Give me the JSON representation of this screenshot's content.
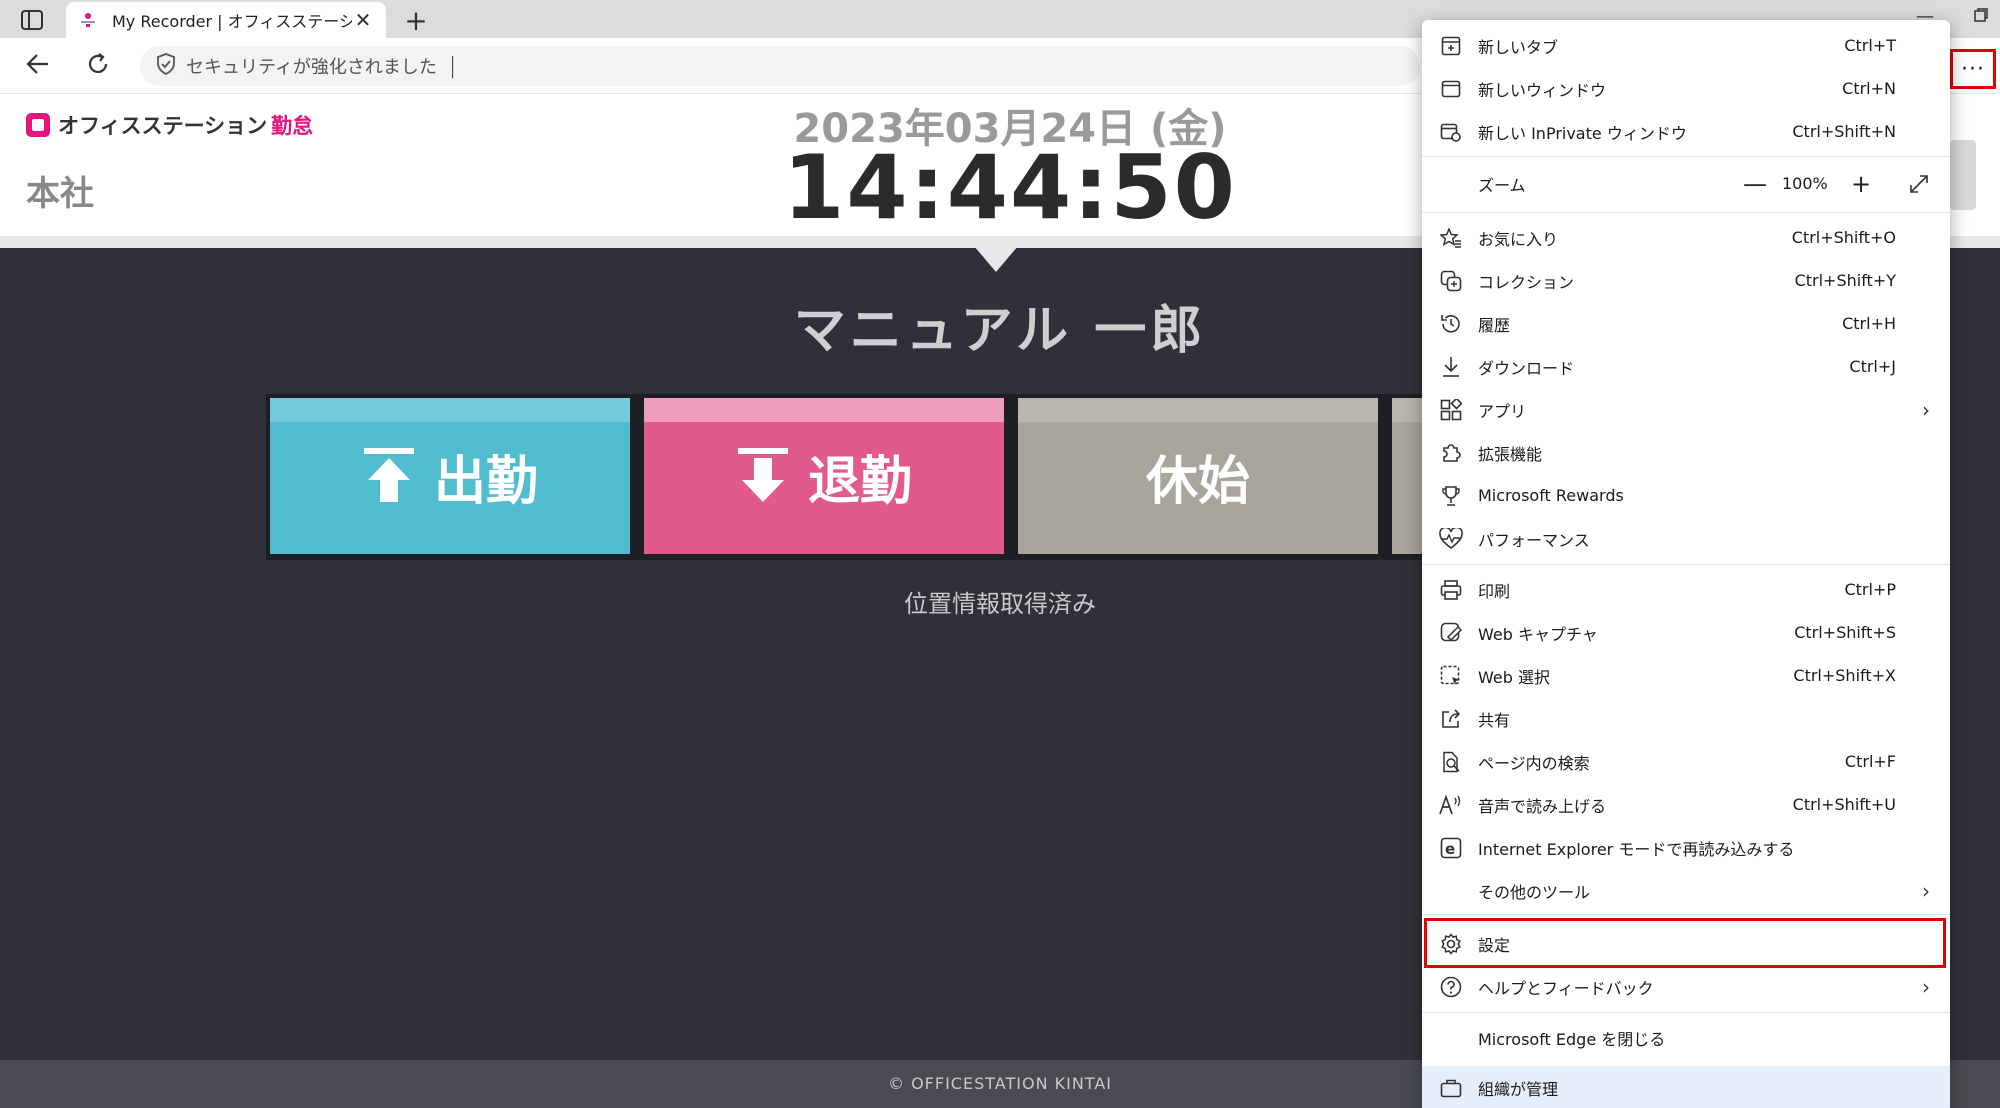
{
  "browser": {
    "tab_title": "My Recorder | オフィスステーション勤",
    "address_text": "セキュリティが強化されました",
    "more_label": "···"
  },
  "header": {
    "logo_text": "オフィスステーション",
    "logo_accent": "勤怠",
    "office": "本社",
    "date": "2023年03月24日 (金)",
    "time": "14:44:50"
  },
  "main": {
    "employee_name": "マニュアル 一郎",
    "buttons": {
      "clock_in": "出勤",
      "clock_out": "退勤",
      "break_start": "休始"
    },
    "location_status": "位置情報取得済み",
    "footer": "© OFFICESTATION KINTAI"
  },
  "menu": {
    "new_tab": {
      "label": "新しいタブ",
      "shortcut": "Ctrl+T"
    },
    "new_window": {
      "label": "新しいウィンドウ",
      "shortcut": "Ctrl+N"
    },
    "new_inprivate": {
      "label": "新しい InPrivate ウィンドウ",
      "shortcut": "Ctrl+Shift+N"
    },
    "zoom": {
      "label": "ズーム",
      "value": "100%",
      "minus": "—",
      "plus": "+"
    },
    "favorites": {
      "label": "お気に入り",
      "shortcut": "Ctrl+Shift+O"
    },
    "collections": {
      "label": "コレクション",
      "shortcut": "Ctrl+Shift+Y"
    },
    "history": {
      "label": "履歴",
      "shortcut": "Ctrl+H"
    },
    "downloads": {
      "label": "ダウンロード",
      "shortcut": "Ctrl+J"
    },
    "apps": {
      "label": "アプリ"
    },
    "extensions": {
      "label": "拡張機能"
    },
    "rewards": {
      "label": "Microsoft Rewards"
    },
    "performance": {
      "label": "パフォーマンス"
    },
    "print": {
      "label": "印刷",
      "shortcut": "Ctrl+P"
    },
    "web_capture": {
      "label": "Web キャプチャ",
      "shortcut": "Ctrl+Shift+S"
    },
    "web_select": {
      "label": "Web 選択",
      "shortcut": "Ctrl+Shift+X"
    },
    "share": {
      "label": "共有"
    },
    "find": {
      "label": "ページ内の検索",
      "shortcut": "Ctrl+F"
    },
    "read_aloud": {
      "label": "音声で読み上げる",
      "shortcut": "Ctrl+Shift+U"
    },
    "ie_mode": {
      "label": "Internet Explorer モードで再読み込みする"
    },
    "more_tools": {
      "label": "その他のツール"
    },
    "settings": {
      "label": "設定"
    },
    "help": {
      "label": "ヘルプとフィードバック"
    },
    "close_edge": {
      "label": "Microsoft Edge を閉じる"
    },
    "managed": {
      "label": "組織が管理"
    }
  },
  "colors": {
    "clock_in": "#52bccf",
    "clock_out": "#e05a8c",
    "break": "#aaa59a",
    "highlight": "#e00000",
    "brand": "#e4157c"
  }
}
